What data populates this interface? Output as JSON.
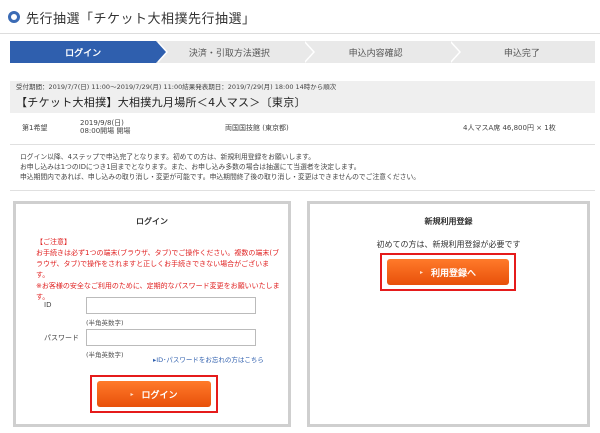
{
  "header": {
    "title": "先行抽選「チケット大相撲先行抽選」"
  },
  "steps": [
    {
      "label": "ログイン",
      "active": true
    },
    {
      "label": "決済・引取方法選択",
      "active": false
    },
    {
      "label": "申込内容確認",
      "active": false
    },
    {
      "label": "申込完了",
      "active": false
    }
  ],
  "event": {
    "period": "受付期間：2019/7/7(日) 11:00〜2019/7/29(月) 11:00結果発表期日：2019/7/29(月) 18:00 14時から順次",
    "title": "【チケット大相撲】大相撲九月場所＜4人マス＞〔東京〕"
  },
  "detail": {
    "choice": "第1希望",
    "date": "2019/9/8(日)",
    "open": "08:00開場 開場",
    "venue": "両国国技館 (東京都)",
    "seat": "4人マスA席  46,800円  ×  1枚"
  },
  "notice": [
    "ログイン以降、4ステップで申込完了となります。初めての方は、新規利用登録をお願いします。",
    "お申し込みは1つのIDにつき1回までとなります。また、お申し込み多数の場合は抽選にて当選者を決定します。",
    "申込期間内であれば、申し込みの取り消し・変更が可能です。申込期間終了後の取り消し・変更はできませんのでご注意ください。"
  ],
  "login": {
    "title": "ログイン",
    "caution": [
      "【ご注意】",
      "お手続きは必ず1つの端末(ブラウザ、タブ)でご操作ください。複数の端末(ブ",
      "ラウザ、タブ)で操作をされますと正しくお手続きできない場合がございます。",
      "※お客様の安全なご利用のために、定期的なパスワード変更をお願いいたしま",
      "す。"
    ],
    "id_label": "ID",
    "id_value": "",
    "id_hint": "(半角英数字)",
    "password_label": "パスワード",
    "password_value": "",
    "password_hint": "(半角英数字)",
    "forgot_link": "▸ID･パスワードをお忘れの方はこちら",
    "button_icon": "▸",
    "button_label": "ログイン"
  },
  "signup": {
    "title": "新規利用登録",
    "text": "初めての方は、新規利用登録が必要です",
    "button_icon": "▸",
    "button_label": "利用登録へ"
  },
  "colors": {
    "step_active": "#2f5fae",
    "button": "#f06a1e",
    "highlight": "#e51b1b",
    "caution": "#e02020"
  }
}
